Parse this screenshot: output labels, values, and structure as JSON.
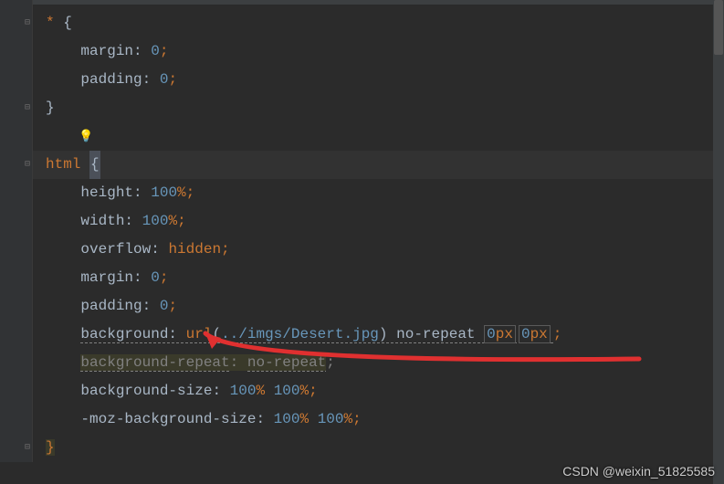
{
  "watermark": "CSDN @weixin_51825585",
  "code": {
    "l1": {
      "sel": "*",
      "brace": "{"
    },
    "l2": {
      "prop": "margin",
      "val": "0"
    },
    "l3": {
      "prop": "padding",
      "val": "0"
    },
    "l4": {
      "brace": "}"
    },
    "l6": {
      "sel": "html",
      "brace": "{"
    },
    "l7": {
      "prop": "height",
      "val": "100",
      "unit": "%"
    },
    "l8": {
      "prop": "width",
      "val": "100",
      "unit": "%"
    },
    "l9": {
      "prop": "overflow",
      "valkw": "hidden"
    },
    "l10": {
      "prop": "margin",
      "val": "0"
    },
    "l11": {
      "prop": "padding",
      "val": "0"
    },
    "l12": {
      "prop": "background",
      "func": "url",
      "arg": "../imgs/Desert.jpg",
      "kw": "no-repeat",
      "n1": "0",
      "u1": "px",
      "n2": "0",
      "u2": "px"
    },
    "l13": {
      "prop": "background-repeat",
      "valkw": "no-repeat"
    },
    "l14": {
      "prop": "background-size",
      "v1": "100",
      "u1": "%",
      "v2": "100",
      "u2": "%"
    },
    "l15": {
      "prop": "-moz-background-size",
      "v1": "100",
      "u1": "%",
      "v2": "100",
      "u2": "%"
    },
    "l16": {
      "brace": "}"
    }
  }
}
